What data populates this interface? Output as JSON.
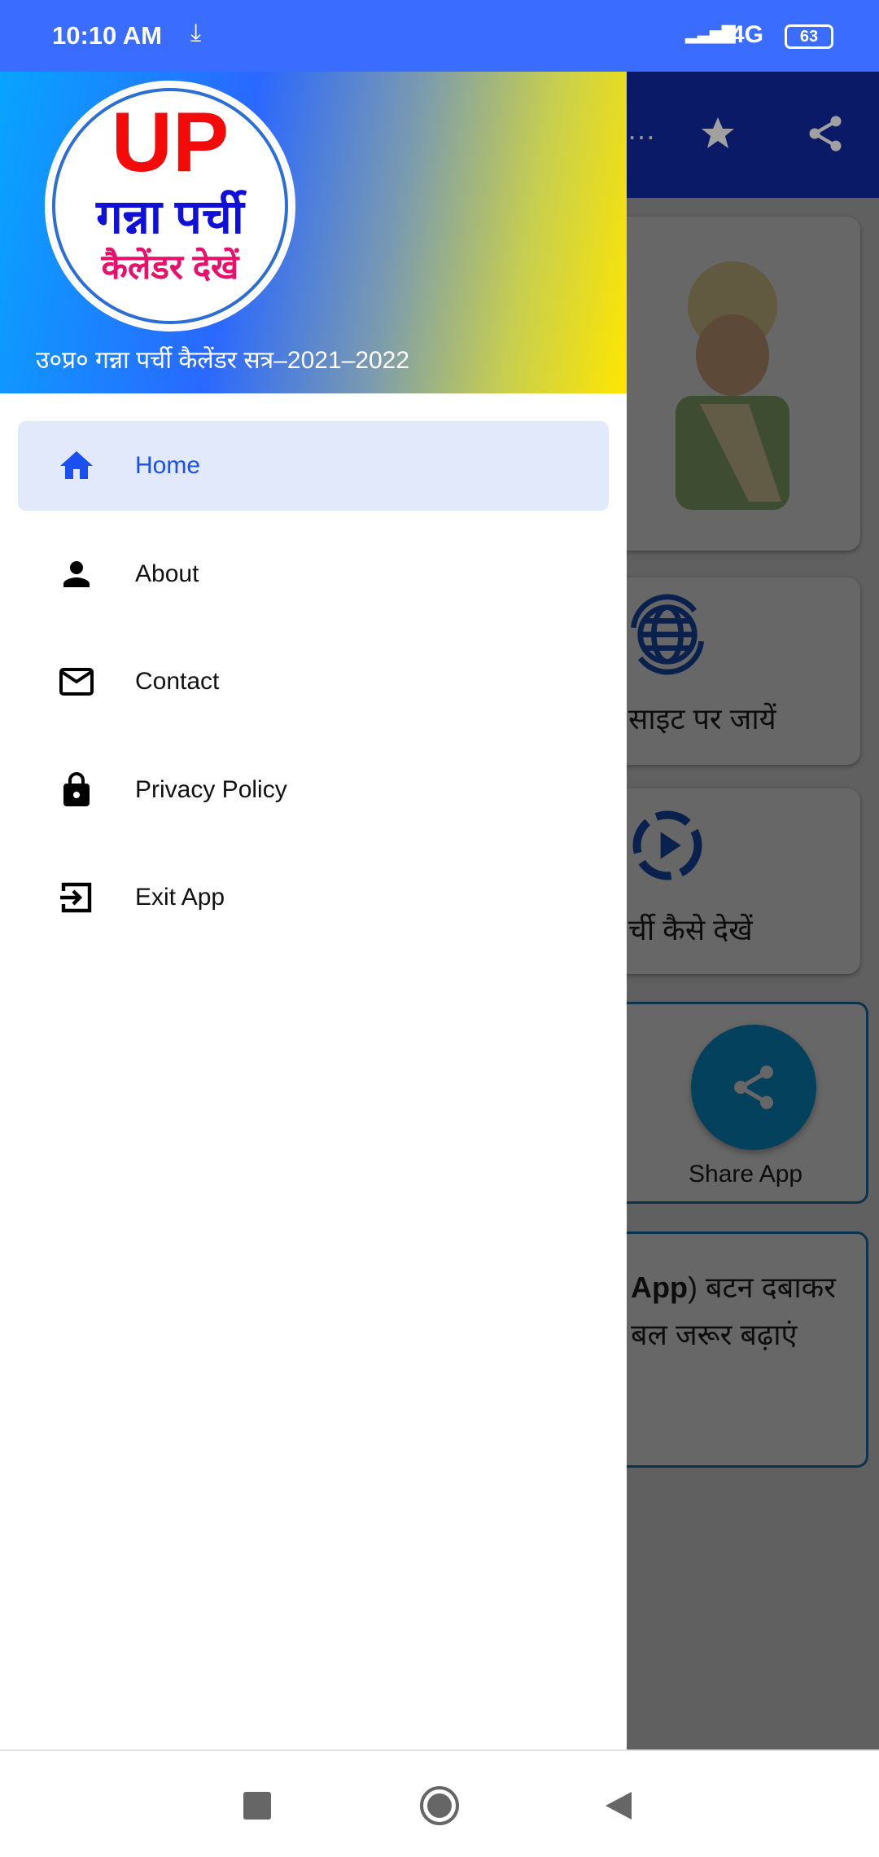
{
  "status_bar": {
    "time": "10:10 AM",
    "network": "4G",
    "battery": "63",
    "icons": [
      "download-icon",
      "signal-icon",
      "battery-icon"
    ]
  },
  "drawer": {
    "logo": {
      "line1": "UP",
      "line2": "गन्ना पर्ची",
      "line3": "कैलेंडर देखें"
    },
    "subtitle": "उ०प्र० गन्ना पर्ची कैलेंडर सत्र–2021–2022",
    "items": [
      {
        "label": "Home",
        "icon": "home-icon",
        "active": true
      },
      {
        "label": "About",
        "icon": "person-icon",
        "active": false
      },
      {
        "label": "Contact",
        "icon": "mail-icon",
        "active": false
      },
      {
        "label": "Privacy Policy",
        "icon": "lock-icon",
        "active": false
      },
      {
        "label": "Exit App",
        "icon": "exit-icon",
        "active": false
      }
    ],
    "accent": "#1a4ff0"
  },
  "background_app": {
    "appbar_icons": [
      "more-icon",
      "star-icon",
      "share-icon"
    ],
    "website_label": "साइट पर जायें",
    "howto_label": "र्ची कैसे देखें",
    "share_label": "Share App",
    "note_line1_bold": "App",
    "note_line1": ") बटन दबाकर",
    "note_line2": "बल जरूर बढ़ाएं"
  }
}
